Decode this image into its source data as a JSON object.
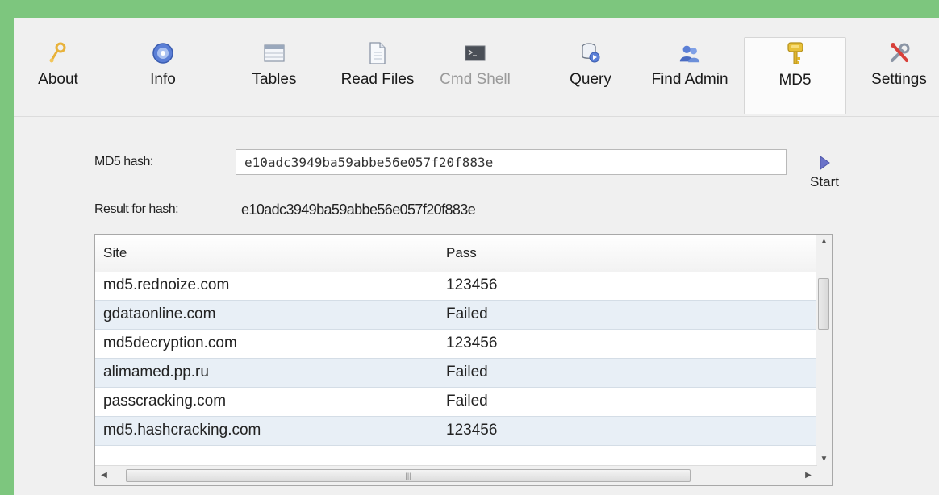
{
  "toolbar": {
    "items": [
      {
        "label": "About",
        "icon": "about-icon"
      },
      {
        "label": "Info",
        "icon": "info-icon"
      },
      {
        "label": "Tables",
        "icon": "tables-icon"
      },
      {
        "label": "Read Files",
        "icon": "read-files-icon"
      },
      {
        "label": "Cmd Shell",
        "icon": "terminal-icon",
        "disabled": true
      },
      {
        "label": "Query",
        "icon": "query-icon"
      },
      {
        "label": "Find Admin",
        "icon": "users-icon"
      },
      {
        "label": "MD5",
        "icon": "key-icon",
        "active": true
      },
      {
        "label": "Settings",
        "icon": "settings-icon"
      }
    ]
  },
  "form": {
    "hash_label": "MD5 hash:",
    "hash_value": "e10adc3949ba59abbe56e057f20f883e",
    "result_label": "Result for hash:",
    "result_value": "e10adc3949ba59abbe56e057f20f883e",
    "start_label": "Start"
  },
  "table": {
    "columns": [
      "Site",
      "Pass"
    ],
    "rows": [
      {
        "site": "md5.rednoize.com",
        "pass": "123456"
      },
      {
        "site": "gdataonline.com",
        "pass": "Failed"
      },
      {
        "site": "md5decryption.com",
        "pass": "123456"
      },
      {
        "site": "alimamed.pp.ru",
        "pass": "Failed"
      },
      {
        "site": "passcracking.com",
        "pass": "Failed"
      },
      {
        "site": "md5.hashcracking.com",
        "pass": "123456"
      }
    ]
  },
  "colors": {
    "background": "#7dc67e",
    "window": "#f0f0f0",
    "row_alt": "#e8eff6",
    "start_arrow": "#6a72c8"
  }
}
